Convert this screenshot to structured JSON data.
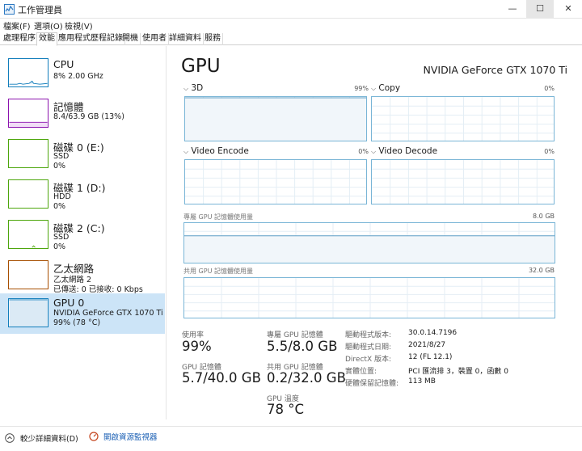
{
  "window": {
    "title": "工作管理員",
    "minimize": "—",
    "maximize": "☐",
    "close": "✕"
  },
  "menu": [
    "檔案(F)",
    "選項(O)",
    "檢視(V)"
  ],
  "tabs": [
    "處理程序",
    "效能",
    "應用程式歷程記錄",
    "開機",
    "使用者",
    "詳細資料",
    "服務"
  ],
  "active_tab": "效能",
  "sidebar": {
    "items": [
      {
        "title": "CPU",
        "lines": [
          "8%  2.00 GHz"
        ],
        "color": "#117dbb"
      },
      {
        "title": "記憶體",
        "lines": [
          "8.4/63.9 GB (13%)"
        ],
        "color": "#8b12ae"
      },
      {
        "title": "磁碟 0 (E:)",
        "lines": [
          "SSD",
          "0%"
        ],
        "color": "#4da60c"
      },
      {
        "title": "磁碟 1 (D:)",
        "lines": [
          "HDD",
          "0%"
        ],
        "color": "#4da60c"
      },
      {
        "title": "磁碟 2 (C:)",
        "lines": [
          "SSD",
          "0%"
        ],
        "color": "#4da60c"
      },
      {
        "title": "乙太網路",
        "lines": [
          "乙太網路 2",
          "已傳送: 0 已接收: 0 Kbps"
        ],
        "color": "#a74f01"
      },
      {
        "title": "GPU 0",
        "lines": [
          "NVIDIA GeForce GTX 1070 Ti",
          "99% (78 °C)"
        ],
        "color": "#117dbb"
      }
    ],
    "selected_index": 6
  },
  "main": {
    "title": "GPU",
    "gpu_name": "NVIDIA GeForce GTX 1070 Ti",
    "engines": [
      {
        "name": "3D",
        "percent": "99%",
        "level": 0.99
      },
      {
        "name": "Copy",
        "percent": "0%",
        "level": 0.0
      },
      {
        "name": "Video Encode",
        "percent": "0%",
        "level": 0.0
      },
      {
        "name": "Video Decode",
        "percent": "0%",
        "level": 0.0
      }
    ],
    "dedicated_mem": {
      "label": "專屬 GPU 記憶體使用量",
      "max": "8.0 GB",
      "level": 0.69
    },
    "shared_mem": {
      "label": "共用 GPU 記憶體使用量",
      "max": "32.0 GB",
      "level": 0.006
    },
    "stats": {
      "utilization_label": "使用率",
      "utilization": "99%",
      "dedicated_label": "專屬 GPU 記憶體",
      "dedicated": "5.5/8.0 GB",
      "gpu_mem_label": "GPU 記憶體",
      "gpu_mem": "5.7/40.0 GB",
      "shared_label": "共用 GPU 記憶體",
      "shared": "0.2/32.0 GB",
      "temp_label": "GPU 溫度",
      "temp": "78 °C"
    },
    "info": [
      {
        "key": "驅動程式版本:",
        "value": "30.0.14.7196"
      },
      {
        "key": "驅動程式日期:",
        "value": "2021/8/27"
      },
      {
        "key": "DirectX 版本:",
        "value": "12 (FL 12.1)"
      },
      {
        "key": "實體位置:",
        "value": "PCI 匯流排 3，裝置 0，函數 0"
      },
      {
        "key": "硬體保留記憶體:",
        "value": "113 MB"
      }
    ]
  },
  "footer": {
    "less_details": "較少詳細資料(D)",
    "resource_monitor": "開啟資源監視器"
  }
}
